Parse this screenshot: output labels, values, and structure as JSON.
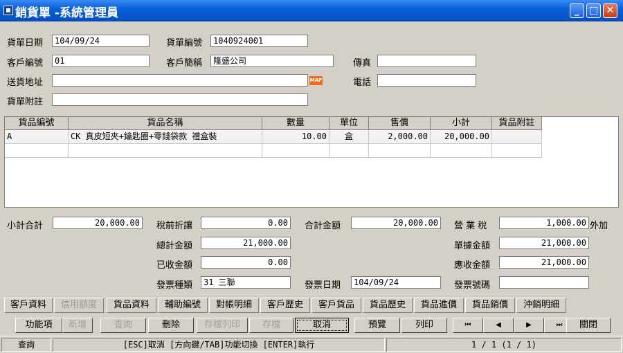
{
  "window": {
    "title": "銷貨單 -系統管理員"
  },
  "header": {
    "invoice_date_label": "貨單日期",
    "invoice_date": "104/09/24",
    "invoice_no_label": "貨單編號",
    "invoice_no": "1040924001",
    "customer_no_label": "客戶編號",
    "customer_no": "01",
    "customer_name_label": "客戶簡稱",
    "customer_name": "隆盛公司",
    "fax_label": "傳真",
    "fax": "",
    "address_label": "送貨地址",
    "address": "",
    "map_label": "MAP",
    "phone_label": "電話",
    "phone": "",
    "note_label": "貨單附註",
    "note": ""
  },
  "grid": {
    "columns": [
      "貨品編號",
      "貨品名稱",
      "數量",
      "單位",
      "售價",
      "小計",
      "貨品附註"
    ],
    "rows": [
      {
        "code": "A",
        "name": "CK 真皮短夾+鑰匙圈+零錢袋款 禮盒裝",
        "qty": "10.00",
        "unit": "盒",
        "price": "2,000.00",
        "subtotal": "20,000.00",
        "note": ""
      }
    ]
  },
  "totals": {
    "subtotal_label": "小計合計",
    "subtotal": "20,000.00",
    "discount_label": "稅前折讓",
    "discount": "0.00",
    "sum_label": "合計金額",
    "sum": "20,000.00",
    "tax_label": "營 業 稅",
    "tax": "1,000.00",
    "tax_suffix": "外加",
    "total_label": "總計金額",
    "total": "21,000.00",
    "doc_amount_label": "單據金額",
    "doc_amount": "21,000.00",
    "received_label": "已收金額",
    "received": "0.00",
    "receivable_label": "應收金額",
    "receivable": "21,000.00",
    "inv_type_label": "發票種類",
    "inv_type": "31 三聯",
    "inv_date_label": "發票日期",
    "inv_date": "104/09/24",
    "inv_no_label": "發票號碼",
    "inv_no": ""
  },
  "tabs": [
    "客戶資料",
    "信用額度",
    "貨品資料",
    "輔助編號",
    "對帳明細",
    "客戶歷史",
    "客戶貨品",
    "貨品歷史",
    "貨品進價",
    "貨品銷價",
    "沖銷明細"
  ],
  "buttons": {
    "func": "功能項",
    "add": "新增",
    "query": "查詢",
    "delete": "刪除",
    "save_print": "存檔列印",
    "save": "存檔",
    "cancel": "取消",
    "preview": "預覽",
    "print": "列印",
    "first": "⏮",
    "prev": "◀",
    "next": "▶",
    "last": "⏭",
    "close": "關閉"
  },
  "status": {
    "mode": "查詢",
    "hint": "[ESC]取消 [方向鍵/TAB]功能切換 [ENTER]執行",
    "page": "1 / 1 (1 / 1)"
  }
}
